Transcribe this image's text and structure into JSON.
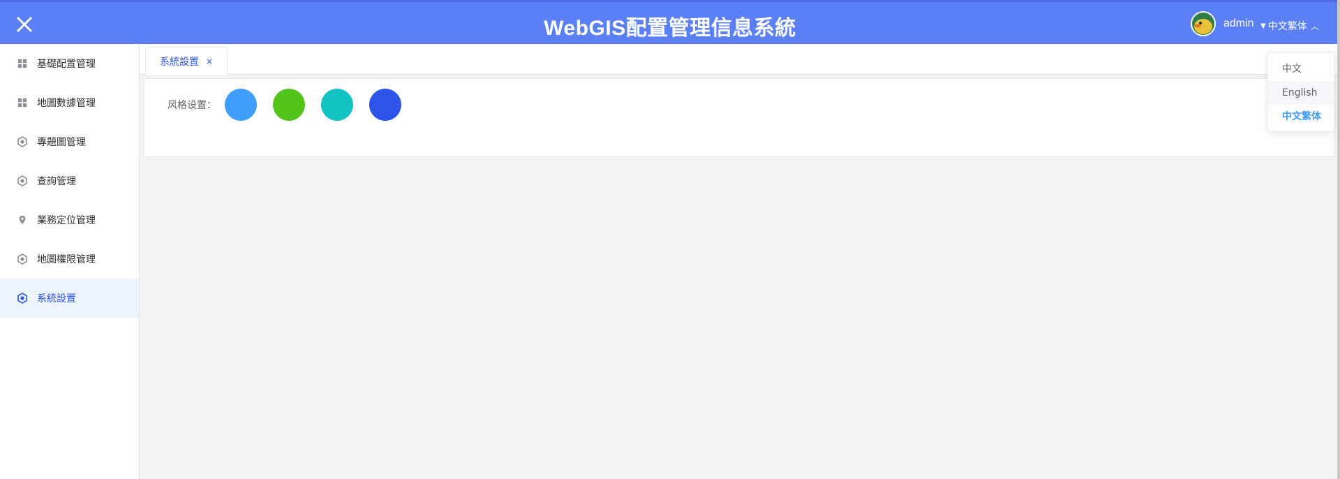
{
  "header": {
    "title": "WebGIS配置管理信息系統",
    "username": "admin",
    "current_language": "中文繁体",
    "background_color": "#5b80f6"
  },
  "sidebar": {
    "items": [
      {
        "label": "基礎配置管理",
        "icon": "grid-icon"
      },
      {
        "label": "地圖數據管理",
        "icon": "grid-icon"
      },
      {
        "label": "專題圖管理",
        "icon": "hexagon-gear-icon"
      },
      {
        "label": "查詢管理",
        "icon": "hexagon-gear-icon"
      },
      {
        "label": "業務定位管理",
        "icon": "location-pin-icon"
      },
      {
        "label": "地圖權限管理",
        "icon": "hexagon-gear-icon"
      },
      {
        "label": "系統設置",
        "icon": "hexagon-gear-icon",
        "active": true
      }
    ]
  },
  "tabs": [
    {
      "label": "系統設置",
      "close": "×"
    }
  ],
  "settings": {
    "style_label": "风格设置：",
    "theme_colors": [
      "#409eff",
      "#52c41a",
      "#13c2c2",
      "#2f54eb"
    ]
  },
  "language_menu": {
    "options": [
      "中文",
      "English",
      "中文繁体"
    ],
    "selected": "中文繁体"
  }
}
